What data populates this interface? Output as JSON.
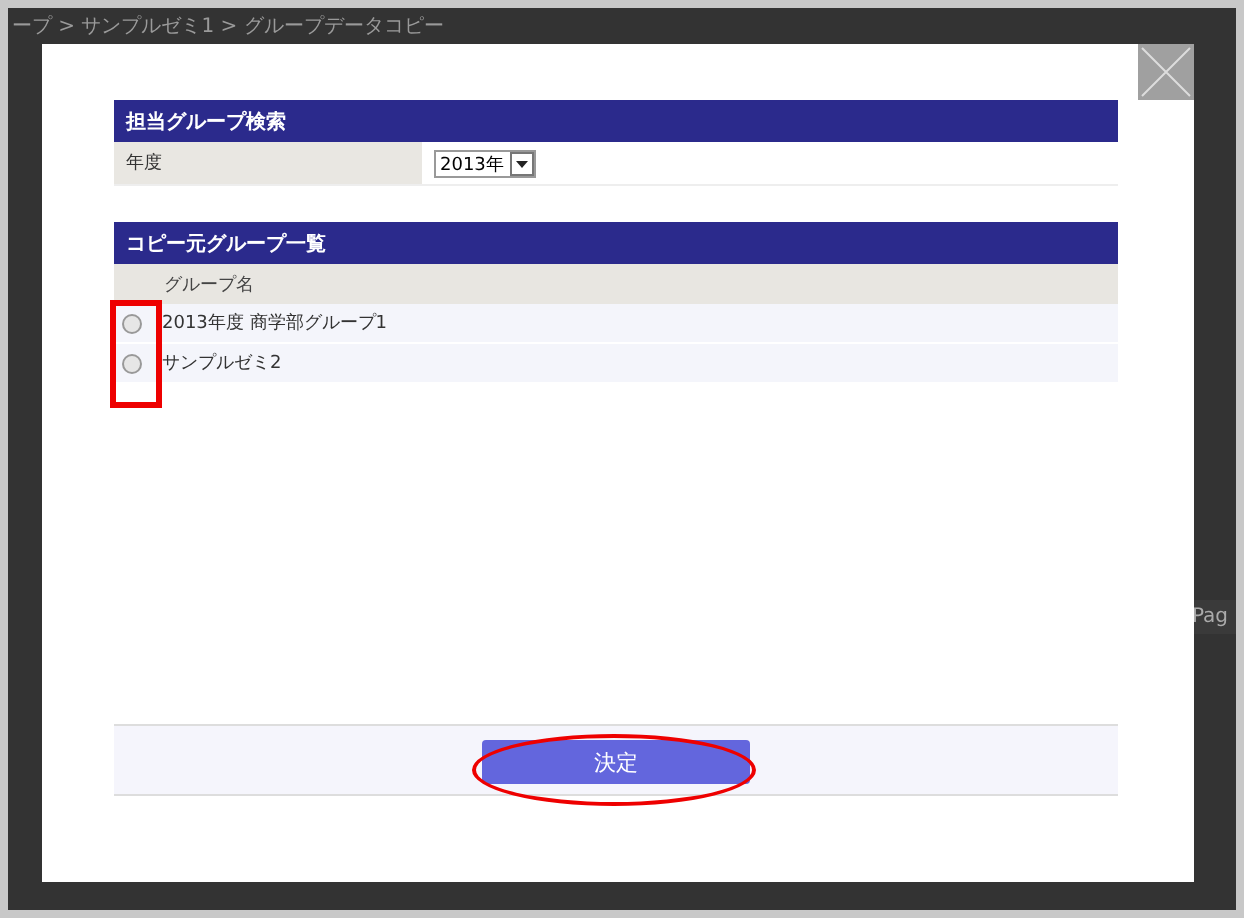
{
  "background_page": {
    "breadcrumb": "ープ > サンプルゼミ1 > グループデータコピー",
    "side_text": "Pag"
  },
  "search_panel": {
    "title": "担当グループ検索",
    "fields": [
      {
        "label": "年度",
        "value": "2013年"
      }
    ]
  },
  "group_list": {
    "title": "コピー元グループ一覧",
    "column": "グループ名",
    "rows": [
      {
        "name": "2013年度  商学部グループ1",
        "selected": false
      },
      {
        "name": "サンプルゼミ2",
        "selected": false
      }
    ]
  },
  "submit_button": {
    "label": "決定"
  },
  "annotations": {
    "radio_highlight": true,
    "button_highlight": true
  }
}
